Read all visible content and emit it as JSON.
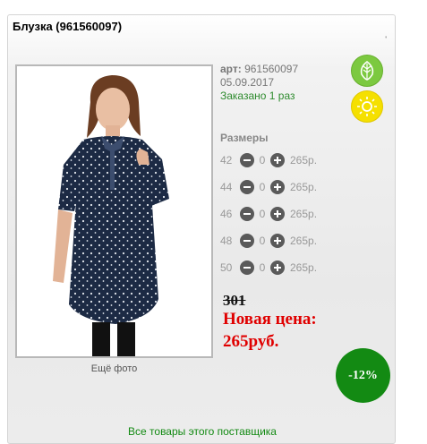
{
  "product": {
    "title": "Блузка (961560097)",
    "tick": "'",
    "art_label": "арт:",
    "art_value": "961560097",
    "date": "05.09.2017",
    "ordered": "Заказано 1 раз",
    "more_photo": "Ещё фото"
  },
  "icons": {
    "eco": "leaf-icon",
    "sun": "sun-icon",
    "minus": "minus-icon",
    "plus": "plus-icon"
  },
  "sizes": {
    "heading": "Размеры",
    "rows": [
      {
        "size": "42",
        "qty": "0",
        "price": "265р."
      },
      {
        "size": "44",
        "qty": "0",
        "price": "265р."
      },
      {
        "size": "46",
        "qty": "0",
        "price": "265р."
      },
      {
        "size": "48",
        "qty": "0",
        "price": "265р."
      },
      {
        "size": "50",
        "qty": "0",
        "price": "265р."
      }
    ]
  },
  "pricing": {
    "old_price": "301",
    "new_label": "Новая цена:",
    "new_price": "265руб.",
    "discount": "-12%"
  },
  "footer": {
    "supplier_link": "Все товары этого поставщика"
  },
  "colors": {
    "accent_green": "#138a13",
    "sale_red": "#e00000",
    "leaf": "#7cc940",
    "sun": "#f5e000"
  }
}
